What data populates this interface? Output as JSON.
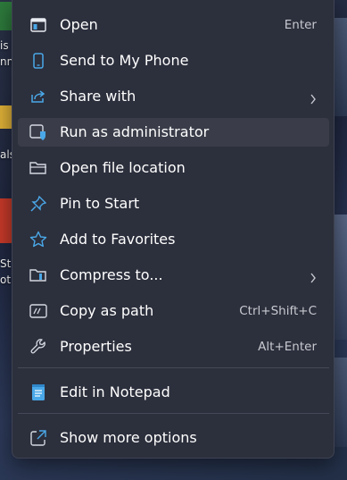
{
  "desktop": {
    "fragments": [
      "is",
      "nn",
      "als",
      "St",
      "otu"
    ]
  },
  "context_menu": {
    "items": [
      {
        "label": "Open",
        "shortcut": "Enter",
        "icon": "app-window-icon"
      },
      {
        "label": "Send to My Phone",
        "icon": "phone-icon"
      },
      {
        "label": "Share with",
        "icon": "share-icon",
        "submenu": true
      },
      {
        "label": "Run as administrator",
        "icon": "shield-icon",
        "highlighted": true
      },
      {
        "label": "Open file location",
        "icon": "folder-icon"
      },
      {
        "label": "Pin to Start",
        "icon": "pin-icon"
      },
      {
        "label": "Add to Favorites",
        "icon": "star-icon"
      },
      {
        "label": "Compress to...",
        "icon": "zip-icon",
        "submenu": true
      },
      {
        "label": "Copy as path",
        "shortcut": "Ctrl+Shift+C",
        "icon": "copy-path-icon"
      },
      {
        "label": "Properties",
        "shortcut": "Alt+Enter",
        "icon": "wrench-icon"
      },
      {
        "label": "Edit in Notepad",
        "icon": "notepad-icon"
      },
      {
        "label": "Show more options",
        "icon": "external-icon"
      }
    ]
  },
  "colors": {
    "menu_bg": "#2c2f3c",
    "hover_bg": "#3a3d49",
    "accent": "#4aa8e8"
  }
}
